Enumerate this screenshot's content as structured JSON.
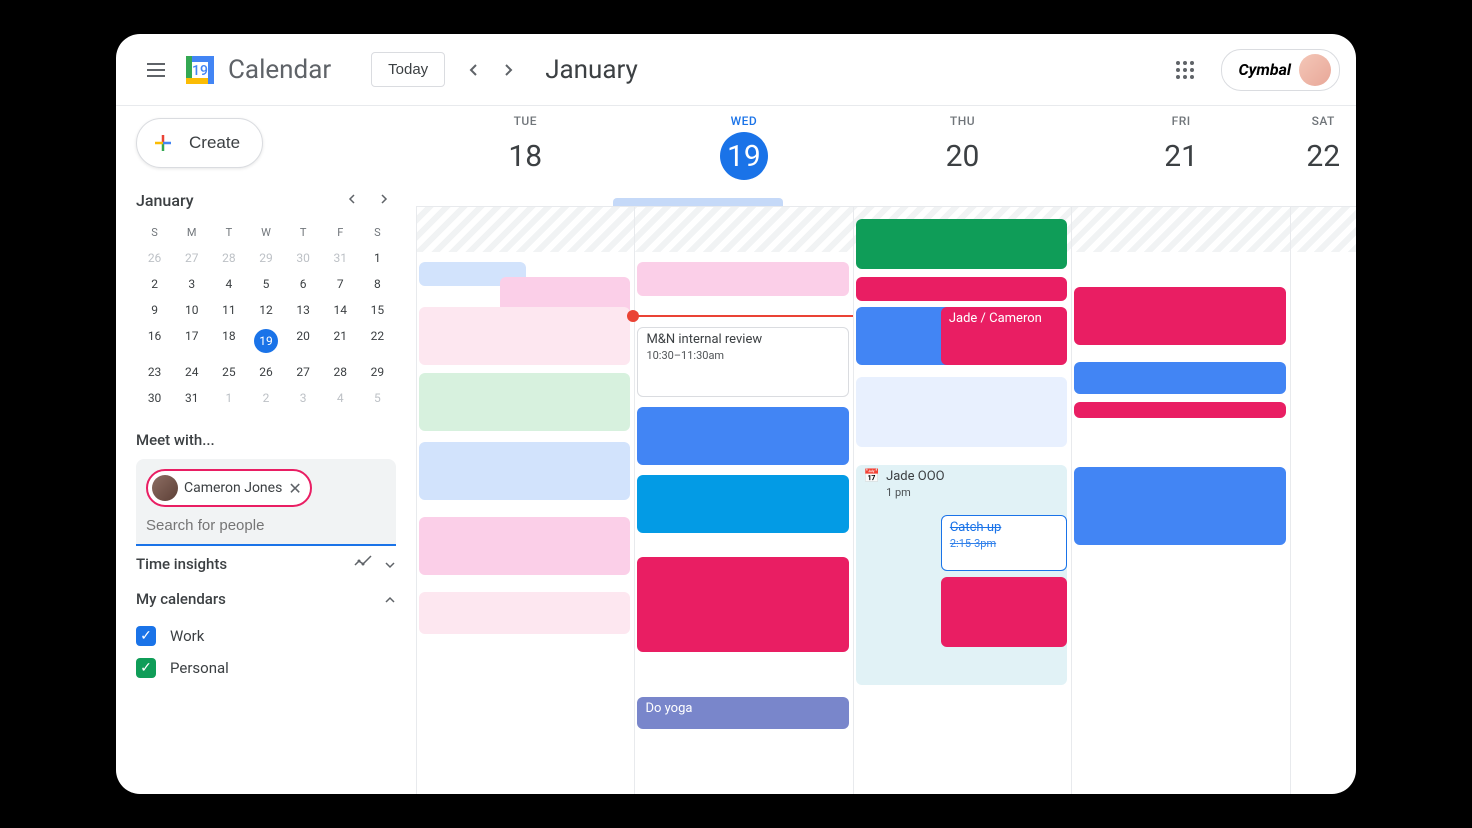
{
  "header": {
    "app_title": "Calendar",
    "today_label": "Today",
    "month_title": "January",
    "org_name": "Cymbal"
  },
  "sidebar": {
    "create_label": "Create",
    "mini_cal_title": "January",
    "dow": [
      "S",
      "M",
      "T",
      "W",
      "T",
      "F",
      "S"
    ],
    "weeks": [
      [
        {
          "n": 26,
          "oom": true
        },
        {
          "n": 27,
          "oom": true
        },
        {
          "n": 28,
          "oom": true
        },
        {
          "n": 29,
          "oom": true
        },
        {
          "n": 30,
          "oom": true
        },
        {
          "n": 31,
          "oom": true
        },
        {
          "n": 1
        }
      ],
      [
        {
          "n": 2
        },
        {
          "n": 3
        },
        {
          "n": 4
        },
        {
          "n": 5
        },
        {
          "n": 6
        },
        {
          "n": 7
        },
        {
          "n": 8
        }
      ],
      [
        {
          "n": 9
        },
        {
          "n": 10
        },
        {
          "n": 11
        },
        {
          "n": 12
        },
        {
          "n": 13
        },
        {
          "n": 14
        },
        {
          "n": 15
        }
      ],
      [
        {
          "n": 16
        },
        {
          "n": 17
        },
        {
          "n": 18
        },
        {
          "n": 19,
          "today": true
        },
        {
          "n": 20
        },
        {
          "n": 21
        },
        {
          "n": 22
        }
      ],
      [
        {
          "n": 23
        },
        {
          "n": 24
        },
        {
          "n": 25
        },
        {
          "n": 26
        },
        {
          "n": 27
        },
        {
          "n": 28
        },
        {
          "n": 29
        }
      ],
      [
        {
          "n": 30
        },
        {
          "n": 31
        },
        {
          "n": 1,
          "oom": true
        },
        {
          "n": 2,
          "oom": true
        },
        {
          "n": 3,
          "oom": true
        },
        {
          "n": 4,
          "oom": true
        },
        {
          "n": 5,
          "oom": true
        }
      ]
    ],
    "meet_with_label": "Meet with...",
    "meet_chip_name": "Cameron Jones",
    "search_placeholder": "Search for people",
    "time_insights_label": "Time insights",
    "my_calendars_label": "My calendars",
    "calendars": [
      {
        "name": "Work",
        "color": "#1a73e8"
      },
      {
        "name": "Personal",
        "color": "#0f9d58"
      }
    ]
  },
  "days": [
    {
      "dow": "TUE",
      "num": "18",
      "today": false
    },
    {
      "dow": "WED",
      "num": "19",
      "today": true
    },
    {
      "dow": "THU",
      "num": "20",
      "today": false
    },
    {
      "dow": "FRI",
      "num": "21",
      "today": false
    },
    {
      "dow": "SAT",
      "num": "22",
      "today": false
    }
  ],
  "events": {
    "wed_alldaypill_color": "#c5d9f8",
    "wed_review_title": "M&N internal review",
    "wed_review_time": "10:30–11:30am",
    "wed_yoga_title": "Do yoga",
    "thu_jade_title": "Jade / Cameron",
    "thu_ooo_title": "Jade OOO",
    "thu_ooo_time": "1 pm",
    "thu_catchup_title": "Catch up",
    "thu_catchup_time": "2:15-3pm"
  },
  "colors": {
    "blue": "#4285f4",
    "skyblue": "#039be5",
    "green": "#0f9d58",
    "pink": "#e91e63",
    "lightpink": "#fbcfe8",
    "palePink": "#fde7f0",
    "paleGreen": "#d7f1de",
    "paleBlue": "#d2e3fc",
    "purple": "#7986cb",
    "red": "#d50000",
    "paleTeal": "#e1f2f6"
  }
}
